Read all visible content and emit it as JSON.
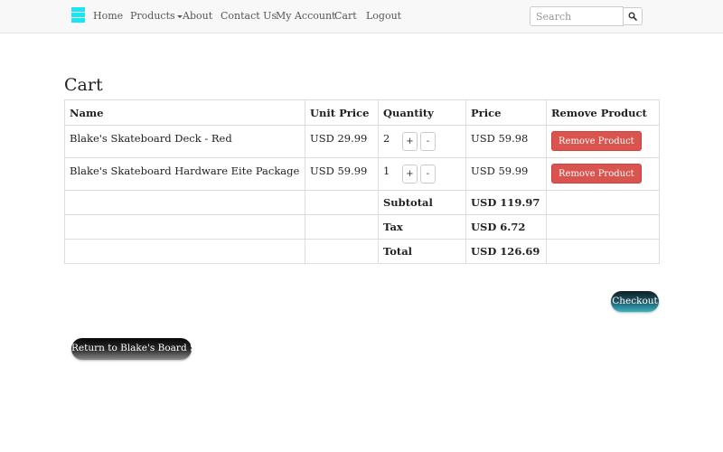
{
  "nav": {
    "items": [
      {
        "label": "Home"
      },
      {
        "label": "Products"
      },
      {
        "label": "About"
      },
      {
        "label": "Contact Us"
      },
      {
        "label": "My Account"
      },
      {
        "label": "Cart"
      },
      {
        "label": "Logout"
      }
    ],
    "search_placeholder": "Search",
    "brand_color": "#19e6f0"
  },
  "cart": {
    "title": "Cart",
    "headers": {
      "name": "Name",
      "unit_price": "Unit Price",
      "quantity": "Quantity",
      "price": "Price",
      "remove": "Remove Product"
    },
    "items": [
      {
        "name": "Blake's Skateboard Deck - Red",
        "unit_price": "USD 29.99",
        "quantity": "2",
        "price": "USD 59.98",
        "plus": "+",
        "minus": "-",
        "remove_label": "Remove Product"
      },
      {
        "name": "Blake's Skateboard Hardware Eite Package",
        "unit_price": "USD 59.99",
        "quantity": "1",
        "price": "USD 59.99",
        "plus": "+",
        "minus": "-",
        "remove_label": "Remove Product"
      }
    ],
    "summary": {
      "subtotal_label": "Subtotal",
      "subtotal_value": "USD 119.97",
      "tax_label": "Tax",
      "tax_value": "USD 6.72",
      "total_label": "Total",
      "total_value": "USD 126.69"
    }
  },
  "actions": {
    "checkout_label": "Checkout",
    "return_label": "Return to Blake's Board Shop"
  },
  "colors": {
    "remove_button": "#d9534f",
    "checkout_accent": "#38b3c4"
  }
}
